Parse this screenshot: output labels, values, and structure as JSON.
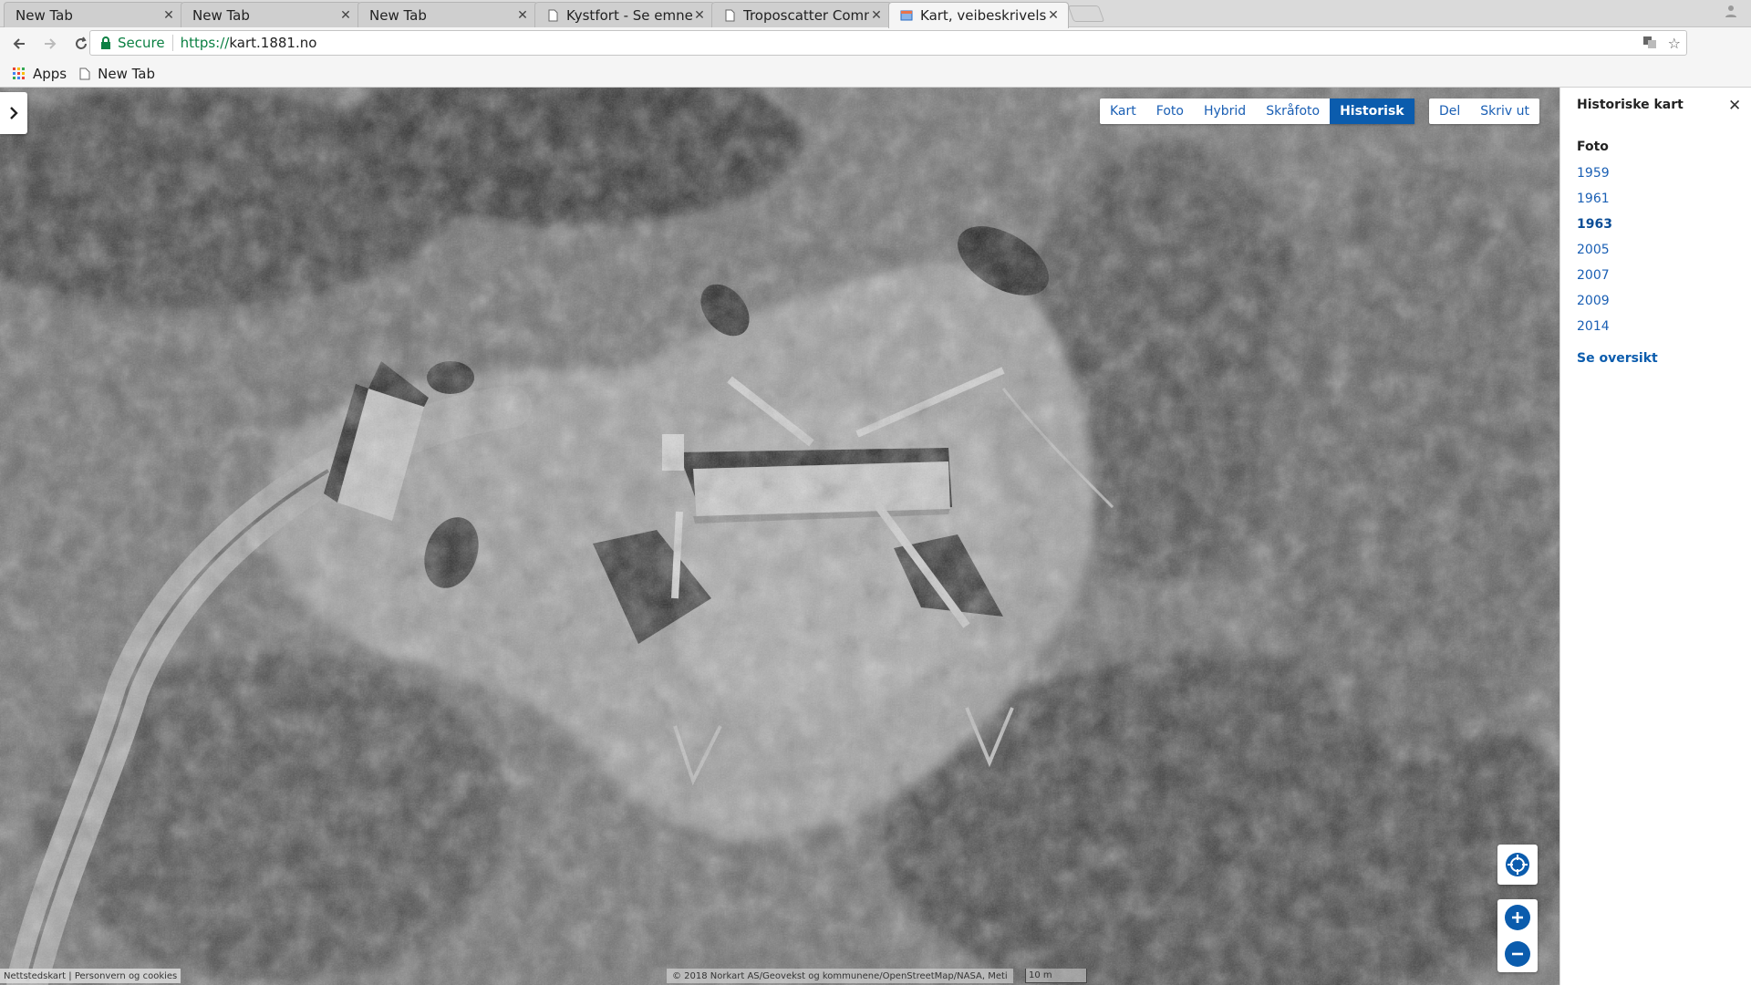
{
  "browser": {
    "tabs": [
      {
        "title": "New Tab",
        "active": false,
        "favicon": "none"
      },
      {
        "title": "New Tab",
        "active": false,
        "favicon": "none"
      },
      {
        "title": "New Tab",
        "active": false,
        "favicon": "none"
      },
      {
        "title": "Kystfort - Se emne -",
        "active": false,
        "favicon": "page-icon"
      },
      {
        "title": "Troposcatter Comm",
        "active": false,
        "favicon": "page-icon"
      },
      {
        "title": "Kart, veibeskrivelse",
        "active": true,
        "favicon": "map-icon"
      }
    ],
    "omnibox": {
      "security_label": "Secure",
      "url_scheme": "https://",
      "url_host": "kart.1881.no"
    },
    "bookmarks": [
      {
        "label": "Apps",
        "icon": "apps-grid-icon"
      },
      {
        "label": "New Tab",
        "icon": "page-icon"
      }
    ]
  },
  "map": {
    "map_types": [
      "Kart",
      "Foto",
      "Hybrid",
      "Skråfoto",
      "Historisk"
    ],
    "active_map_type": "Historisk",
    "actions": [
      "Del",
      "Skriv ut"
    ],
    "footer_links": "Nettstedskart | Personvern og cookies",
    "attribution": "© 2018 Norkart AS/Geovekst og kommunene/OpenStreetMap/NASA, Meti",
    "scale_label": "10 m",
    "colors": {
      "accent": "#0b5cad",
      "link": "#1a5fb4"
    }
  },
  "panel": {
    "title": "Historiske kart",
    "section": "Foto",
    "years": [
      "1959",
      "1961",
      "1963",
      "2005",
      "2007",
      "2009",
      "2014"
    ],
    "active_year": "1963",
    "overview_link": "Se oversikt"
  }
}
